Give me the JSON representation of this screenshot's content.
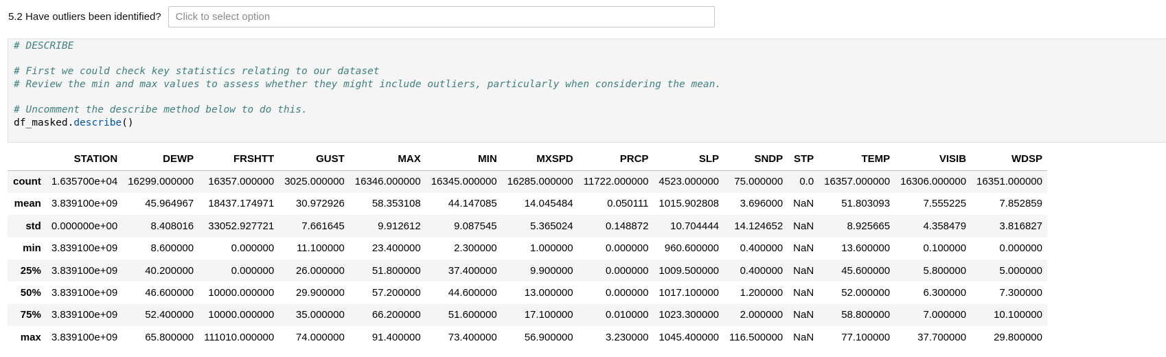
{
  "question": {
    "label": "5.2 Have outliers been identified?",
    "select_placeholder": "Click to select option"
  },
  "code_cell": {
    "lines": [
      "# DESCRIBE",
      "",
      "# First we could check key statistics relating to our dataset",
      "# Review the min and max values to assess whether they might include outliers, particularly when considering the mean.",
      "",
      "# Uncomment the describe method below to do this.",
      "df_masked.describe()"
    ],
    "call_object": "df_masked",
    "call_dot": ".",
    "call_method": "describe",
    "call_parens": "()"
  },
  "table": {
    "columns": [
      "",
      "STATION",
      "DEWP",
      "FRSHTT",
      "GUST",
      "MAX",
      "MIN",
      "MXSPD",
      "PRCP",
      "SLP",
      "SNDP",
      "STP",
      "TEMP",
      "VISIB",
      "WDSP"
    ],
    "rows": [
      {
        "label": "count",
        "values": [
          "1.635700e+04",
          "16299.000000",
          "16357.000000",
          "3025.000000",
          "16346.000000",
          "16345.000000",
          "16285.000000",
          "11722.000000",
          "4523.000000",
          "75.000000",
          "0.0",
          "16357.000000",
          "16306.000000",
          "16351.000000"
        ]
      },
      {
        "label": "mean",
        "values": [
          "3.839100e+09",
          "45.964967",
          "18437.174971",
          "30.972926",
          "58.353108",
          "44.147085",
          "14.045484",
          "0.050111",
          "1015.902808",
          "3.696000",
          "NaN",
          "51.803093",
          "7.555225",
          "7.852859"
        ]
      },
      {
        "label": "std",
        "values": [
          "0.000000e+00",
          "8.408016",
          "33052.927721",
          "7.661645",
          "9.912612",
          "9.087545",
          "5.365024",
          "0.148872",
          "10.704444",
          "14.124652",
          "NaN",
          "8.925665",
          "4.358479",
          "3.816827"
        ]
      },
      {
        "label": "min",
        "values": [
          "3.839100e+09",
          "8.600000",
          "0.000000",
          "11.100000",
          "23.400000",
          "2.300000",
          "1.000000",
          "0.000000",
          "960.600000",
          "0.400000",
          "NaN",
          "13.600000",
          "0.100000",
          "0.000000"
        ]
      },
      {
        "label": "25%",
        "values": [
          "3.839100e+09",
          "40.200000",
          "0.000000",
          "26.000000",
          "51.800000",
          "37.400000",
          "9.900000",
          "0.000000",
          "1009.500000",
          "0.400000",
          "NaN",
          "45.600000",
          "5.800000",
          "5.000000"
        ]
      },
      {
        "label": "50%",
        "values": [
          "3.839100e+09",
          "46.600000",
          "10000.000000",
          "29.900000",
          "57.200000",
          "44.600000",
          "13.000000",
          "0.000000",
          "1017.100000",
          "1.200000",
          "NaN",
          "52.000000",
          "6.300000",
          "7.300000"
        ]
      },
      {
        "label": "75%",
        "values": [
          "3.839100e+09",
          "52.400000",
          "10000.000000",
          "35.000000",
          "66.200000",
          "51.600000",
          "17.100000",
          "0.010000",
          "1023.300000",
          "2.000000",
          "NaN",
          "58.800000",
          "7.000000",
          "10.100000"
        ]
      },
      {
        "label": "max",
        "values": [
          "3.839100e+09",
          "65.800000",
          "111010.000000",
          "74.000000",
          "91.400000",
          "73.400000",
          "56.900000",
          "3.230000",
          "1045.400000",
          "116.500000",
          "NaN",
          "77.100000",
          "37.700000",
          "29.800000"
        ]
      }
    ]
  }
}
